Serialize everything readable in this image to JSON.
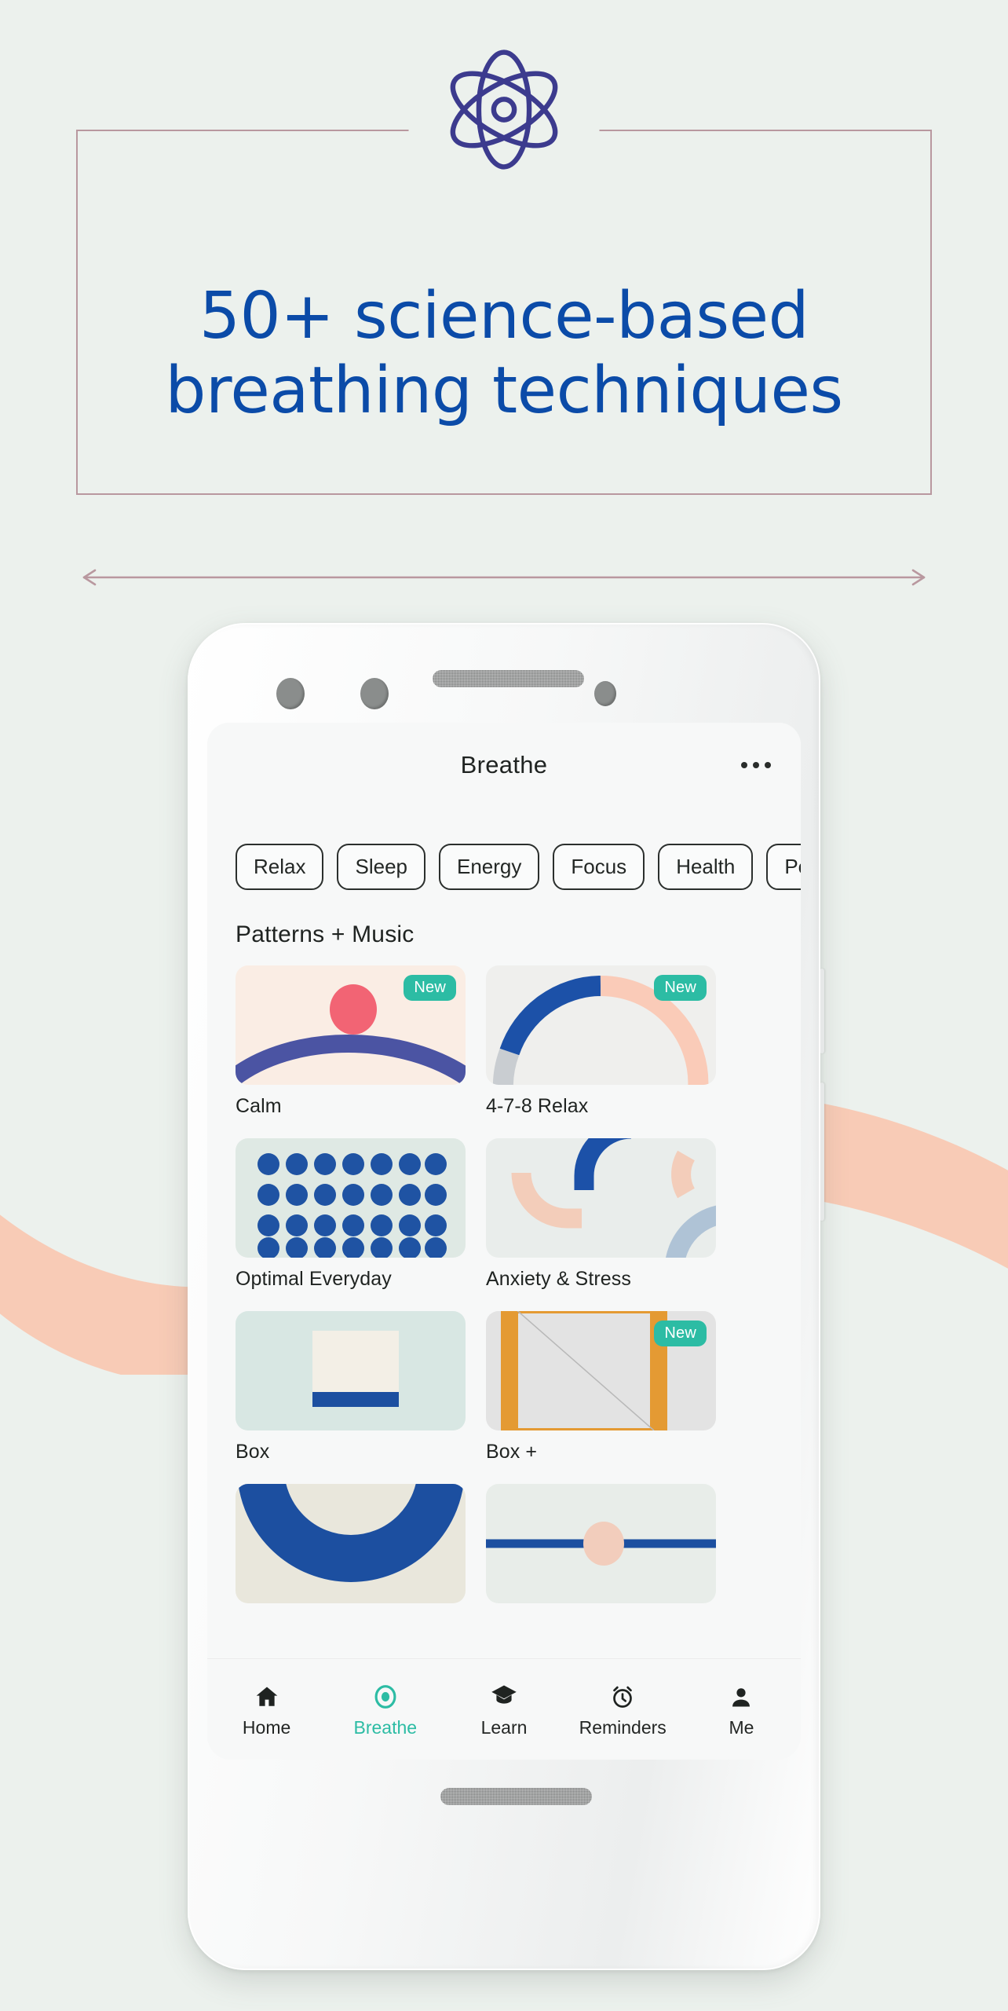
{
  "page": {
    "background_color": "#ECF1ED",
    "accent_blue": "#0B4BA8",
    "accent_teal": "#2CBCA4",
    "rule_color": "#B9989F",
    "wave_color": "#F8CBB6"
  },
  "hero": {
    "icon": "atom-icon",
    "headline_line1": "50+ science-based",
    "headline_line2": "breathing techniques"
  },
  "phone": {
    "appbar": {
      "title": "Breathe",
      "more_icon": "overflow-menu-icon"
    },
    "chips": [
      {
        "label": "Relax"
      },
      {
        "label": "Sleep"
      },
      {
        "label": "Energy"
      },
      {
        "label": "Focus"
      },
      {
        "label": "Health"
      },
      {
        "label": "Perf"
      }
    ],
    "section_title": "Patterns + Music",
    "badge_label": "New",
    "cards": [
      {
        "label": "Calm",
        "art": "arc-dot",
        "badge": "New",
        "bg": "#FAEDE4"
      },
      {
        "label": "4-7-8 Relax",
        "art": "gauge",
        "badge": "New",
        "bg": "#EFEFED"
      },
      {
        "label": "Optimal Everyday",
        "art": "dot-grid",
        "badge": "",
        "bg": "#DFE9E4"
      },
      {
        "label": "Anxiety & Stress",
        "art": "quad-arcs",
        "badge": "",
        "bg": "#E9EDEB"
      },
      {
        "label": "Box",
        "art": "box-square",
        "badge": "",
        "bg": "#D8E7E3"
      },
      {
        "label": "Box +",
        "art": "box-outline",
        "badge": "New",
        "bg": "#E3E3E3"
      },
      {
        "label": "",
        "art": "u-arc",
        "badge": "",
        "bg": "#E9E7DC"
      },
      {
        "label": "",
        "art": "line-dot",
        "badge": "",
        "bg": "#E8EDE9"
      }
    ],
    "tabs": [
      {
        "label": "Home",
        "icon": "home-icon",
        "active": false
      },
      {
        "label": "Breathe",
        "icon": "breathe-ring-icon",
        "active": true
      },
      {
        "label": "Learn",
        "icon": "graduation-cap-icon",
        "active": false
      },
      {
        "label": "Reminders",
        "icon": "alarm-clock-icon",
        "active": false
      },
      {
        "label": "Me",
        "icon": "person-icon",
        "active": false
      }
    ]
  }
}
